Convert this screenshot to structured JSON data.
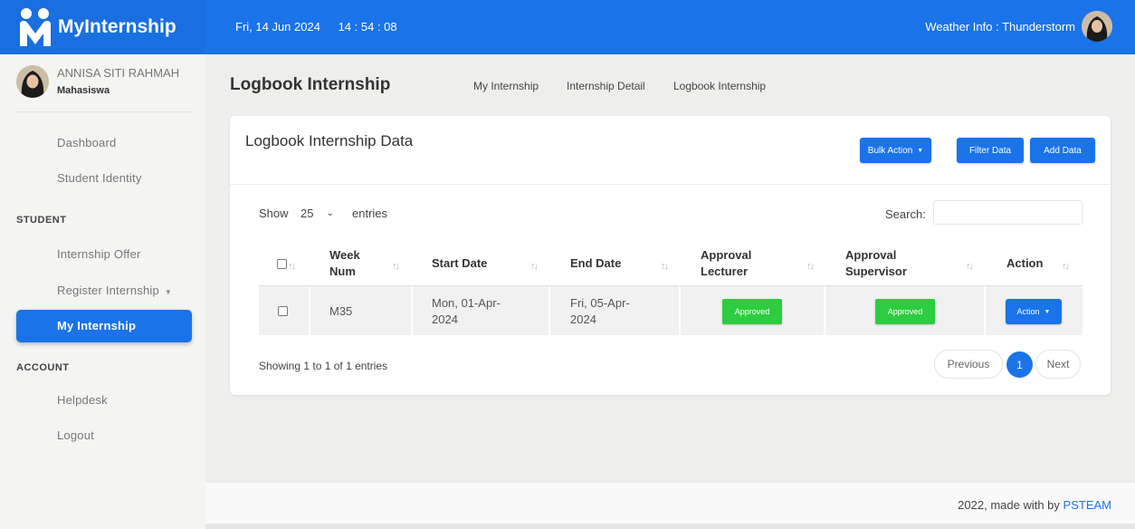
{
  "app": {
    "name": "MyInternship"
  },
  "header": {
    "date": "Fri, 14 Jun 2024",
    "time": "14 : 54 : 08",
    "weather": "Weather Info : Thunderstorm"
  },
  "user": {
    "name": "ANNISA SITI RAHMAH",
    "role": "Mahasiswa"
  },
  "sidebar": {
    "items_top": [
      {
        "label": "Dashboard"
      },
      {
        "label": "Student Identity"
      }
    ],
    "section_student": "STUDENT",
    "student_items": [
      {
        "label": "Internship Offer"
      },
      {
        "label": "Register Internship"
      },
      {
        "label": "My Internship"
      }
    ],
    "section_account": "ACCOUNT",
    "account_items": [
      {
        "label": "Helpdesk"
      },
      {
        "label": "Logout"
      }
    ]
  },
  "page": {
    "title": "Logbook Internship",
    "breadcrumbs": [
      "My Internship",
      "Internship Detail",
      "Logbook Internship"
    ]
  },
  "card": {
    "title": "Logbook Internship Data",
    "bulk_action": "Bulk Action",
    "filter_data": "Filter Data",
    "add_data": "Add Data"
  },
  "table": {
    "show_label": "Show",
    "show_value": "25",
    "entries_label": "entries",
    "search_label": "Search:",
    "search_value": "",
    "headers": {
      "week_num_1": "Week",
      "week_num_2": "Num",
      "start_date": "Start Date",
      "end_date": "End Date",
      "approval_lecturer_1": "Approval",
      "approval_lecturer_2": "Lecturer",
      "approval_supervisor_1": "Approval",
      "approval_supervisor_2": "Supervisor",
      "action": "Action"
    },
    "rows": [
      {
        "week": "M35",
        "start_1": "Mon, 01-Apr-",
        "start_2": "2024",
        "end_1": "Fri, 05-Apr-",
        "end_2": "2024",
        "lecturer": "Approved",
        "supervisor": "Approved",
        "action": "Action"
      }
    ],
    "info": "Showing 1 to 1 of 1 entries",
    "pagination": {
      "previous": "Previous",
      "current": "1",
      "next": "Next"
    }
  },
  "footer": {
    "text": "2022, made with by ",
    "link": "PSTEAM"
  },
  "colors": {
    "primary": "#1a73e8",
    "success": "#2ecc40"
  }
}
